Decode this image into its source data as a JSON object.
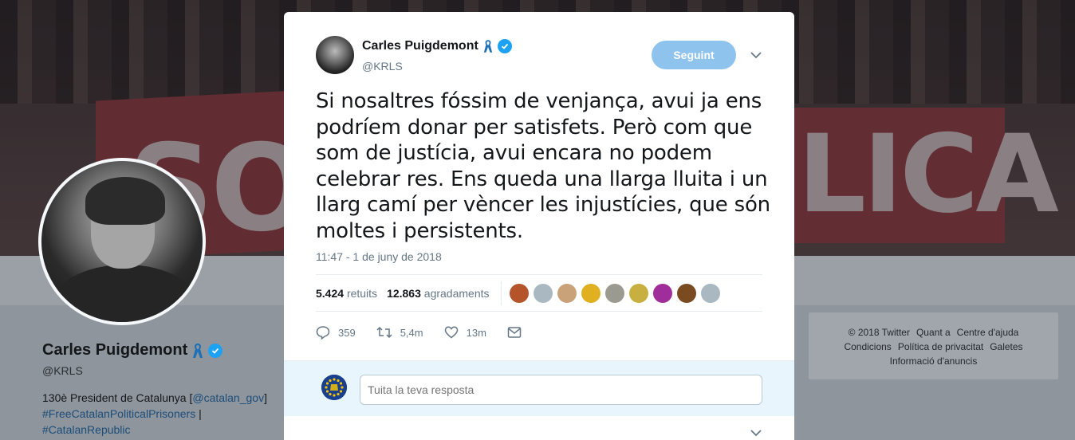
{
  "profile": {
    "name": "Carles Puigdemont",
    "handle": "@KRLS",
    "bio_prefix": "130è President de Catalunya [",
    "bio_link1": "@catalan_gov",
    "bio_suffix": "]",
    "bio_tag1": "#FreeCatalanPoliticalPrisoners",
    "bio_sep": " |",
    "bio_tag2": "#CatalanRepublic"
  },
  "footer": {
    "items": [
      "© 2018 Twitter",
      "Quant a",
      "Centre d'ajuda",
      "Condicions",
      "Política de privacitat",
      "Galetes",
      "Informació d'anuncis"
    ]
  },
  "tweet": {
    "author_name": "Carles Puigdemont",
    "author_handle": "@KRLS",
    "follow_label": "Seguint",
    "text": "Si nosaltres fóssim de venjança, avui ja ens podríem donar per satisfets. Però com que som de justícia, avui encara no podem celebrar res. Ens queda una llarga lluita i un llarg camí per vèncer les injustícies, que són moltes i persistents.",
    "timestamp": "11:47 - 1 de juny de 2018",
    "retweets_count": "5.424",
    "retweets_label": "retuits",
    "likes_count": "12.863",
    "likes_label": "agradaments",
    "liker_colors": [
      "#b5542a",
      "#aab8c2",
      "#c9a27a",
      "#e0b020",
      "#9a9a90",
      "#c8b040",
      "#a02e9a",
      "#7a4a20",
      "#aab8c2"
    ],
    "replies": "359",
    "retweets_short": "5,4m",
    "likes_short": "13m"
  },
  "reply": {
    "placeholder": "Tuita la teva resposta"
  },
  "colors": {
    "accent": "#1da1f2",
    "follow_button": "#8ec3ee",
    "ribbon": "#1d6fb8"
  }
}
